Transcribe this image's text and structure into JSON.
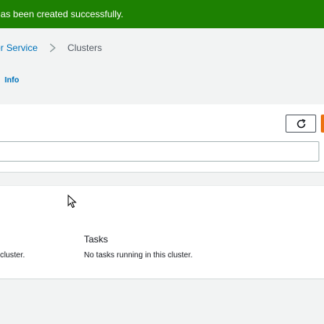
{
  "flash": {
    "message": "has been created successfully."
  },
  "breadcrumb": {
    "parent": "er Service",
    "current": "Clusters"
  },
  "header": {
    "info_link": "Info"
  },
  "toolbar": {
    "refresh_icon": "refresh-icon"
  },
  "search": {
    "placeholder": ""
  },
  "cards": {
    "tasks_heading": "Tasks",
    "left_empty_text": "cluster.",
    "tasks_empty_text": "No tasks running in this cluster."
  },
  "colors": {
    "success": "#1d8102",
    "link": "#0073bb",
    "primary_button": "#ec7211",
    "background": "#f2f3f3"
  }
}
